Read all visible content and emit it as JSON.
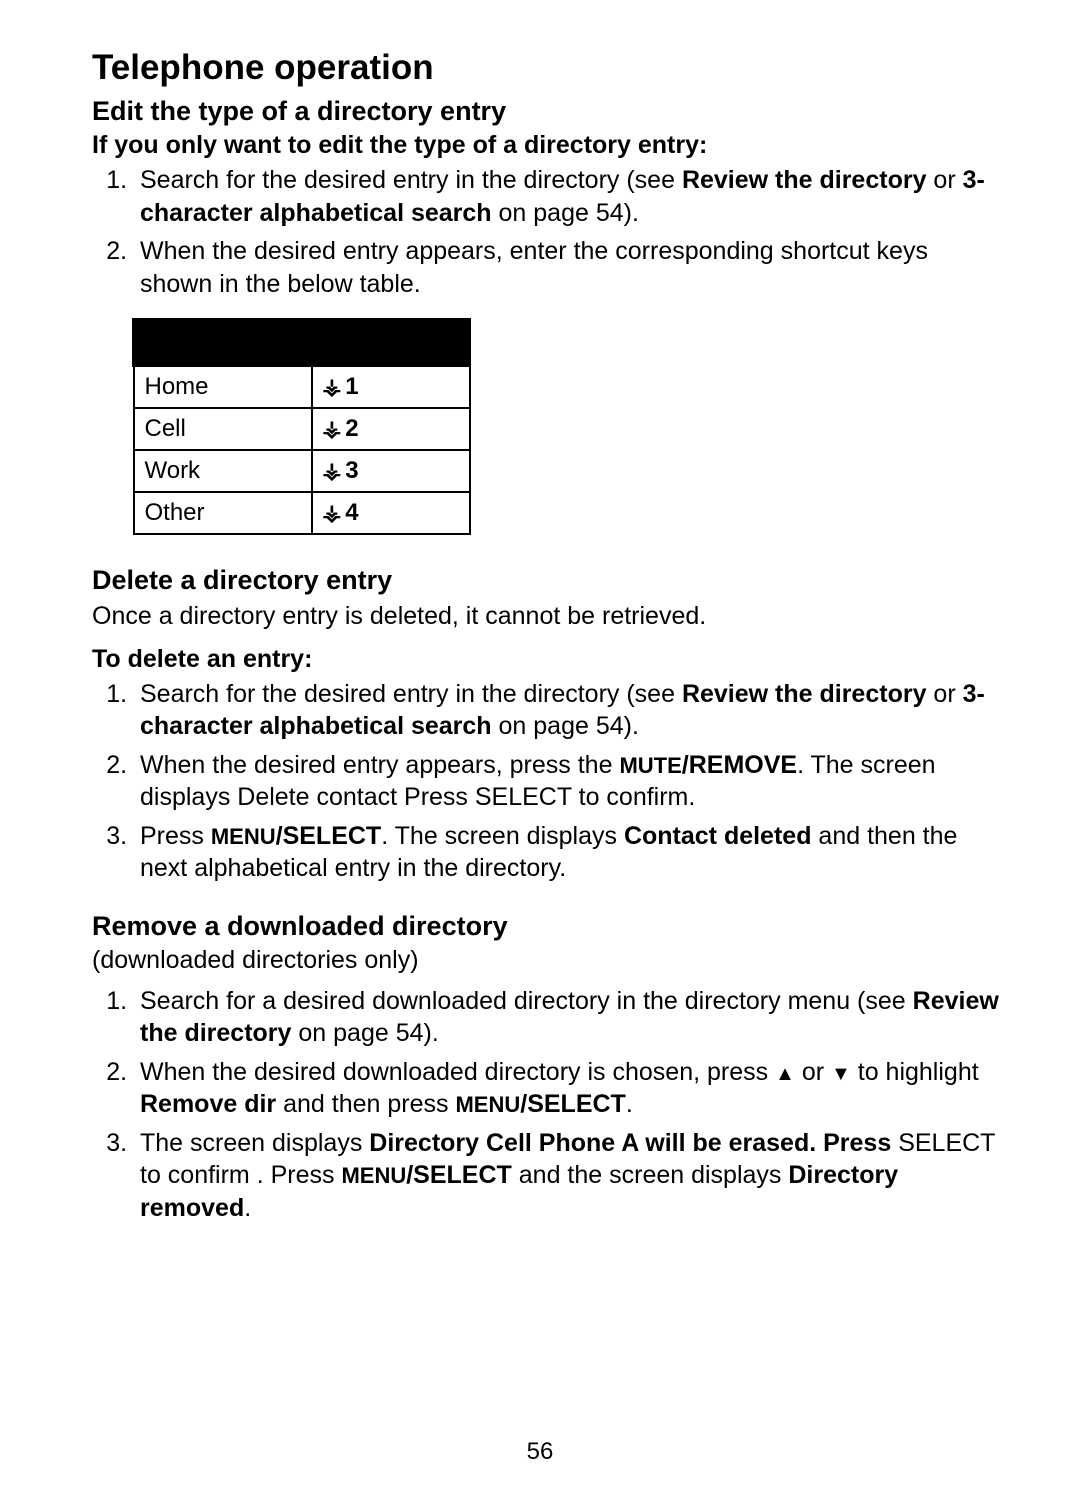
{
  "h1": "Telephone operation",
  "sec1": {
    "h2": "Edit the type of a directory entry",
    "sub": "If you only want to edit the type of a directory entry:",
    "li1": {
      "pre": "Search for the desired entry in the directory (see ",
      "ref1": "Review the directory",
      "mid": " or ",
      "ref2": "3-character alphabetical search",
      "post": " on page 54)."
    },
    "li2": "When the desired entry appears, enter the corresponding shortcut keys shown in the below table."
  },
  "table": {
    "rows": [
      {
        "type": "Home",
        "key": "1"
      },
      {
        "type": "Cell",
        "key": "2"
      },
      {
        "type": "Work",
        "key": "3"
      },
      {
        "type": "Other",
        "key": "4"
      }
    ],
    "sym": "⚶"
  },
  "sec2": {
    "h2": "Delete a directory entry",
    "intro": "Once a directory entry is deleted, it cannot be retrieved.",
    "sub": "To delete an entry:",
    "li1": {
      "pre": "Search for the desired entry in the directory (see ",
      "ref1": "Review the directory",
      "mid": " or ",
      "ref2": "3-character alphabetical search",
      "post": " on page 54)."
    },
    "li2": {
      "pre": "When the desired entry appears, press the ",
      "key1a": "MUTE",
      "key1b": "/REMOVE",
      "post": ". The screen displays Delete contact    Press SELECT to confirm."
    },
    "li3": {
      "pre": "Press ",
      "key1a": "MENU",
      "key1b": "/SELECT",
      "mid": ". The screen displays ",
      "ref": "Contact deleted",
      "post": " and then the next alphabetical entry in the directory."
    }
  },
  "sec3": {
    "h2": "Remove a downloaded directory",
    "note": "(downloaded directories only)",
    "li1": {
      "pre": "Search for a desired downloaded directory in the directory menu (see ",
      "ref": "Review the directory",
      "post": " on page 54)."
    },
    "li2": {
      "pre": "When the desired downloaded directory is chosen, press ",
      "up": "▲",
      "mid1": " or ",
      "down": "▼",
      "mid2": " to highlight ",
      "ref": "Remove dir",
      "mid3": " and then press ",
      "key1a": "MENU",
      "key1b": "/SELECT",
      "post": "."
    },
    "li3": {
      "pre": "The screen displays ",
      "ref1": "Directory Cell Phone A will be erased. Press",
      "line2a": " SELECT to confirm  . Press ",
      "key1a": "MENU",
      "key1b": "/SELECT",
      "mid": " and the screen displays ",
      "ref2": "Directory removed",
      "post": "."
    }
  },
  "page": "56"
}
